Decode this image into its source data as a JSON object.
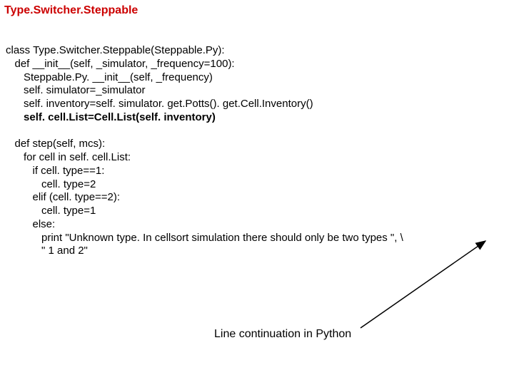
{
  "title": "Type.Switcher.Steppable",
  "code": {
    "l01": "class Type.Switcher.Steppable(Steppable.Py):",
    "l02": "   def __init__(self, _simulator, _frequency=100):",
    "l03": "      Steppable.Py. __init__(self, _frequency)",
    "l04": "      self. simulator=_simulator",
    "l05": "      self. inventory=self. simulator. get.Potts(). get.Cell.Inventory()",
    "l06": "      self. cell.List=Cell.List(self. inventory)",
    "l07": "",
    "l08": "   def step(self, mcs):",
    "l09": "      for cell in self. cell.List:",
    "l10": "         if cell. type==1:",
    "l11": "            cell. type=2",
    "l12": "         elif (cell. type==2):",
    "l13": "            cell. type=1",
    "l14": "         else:",
    "l15": "            print \"Unknown type. In cellsort simulation there should only be two types \", \\",
    "l16": "            \" 1 and 2\""
  },
  "caption": "Line continuation in Python"
}
